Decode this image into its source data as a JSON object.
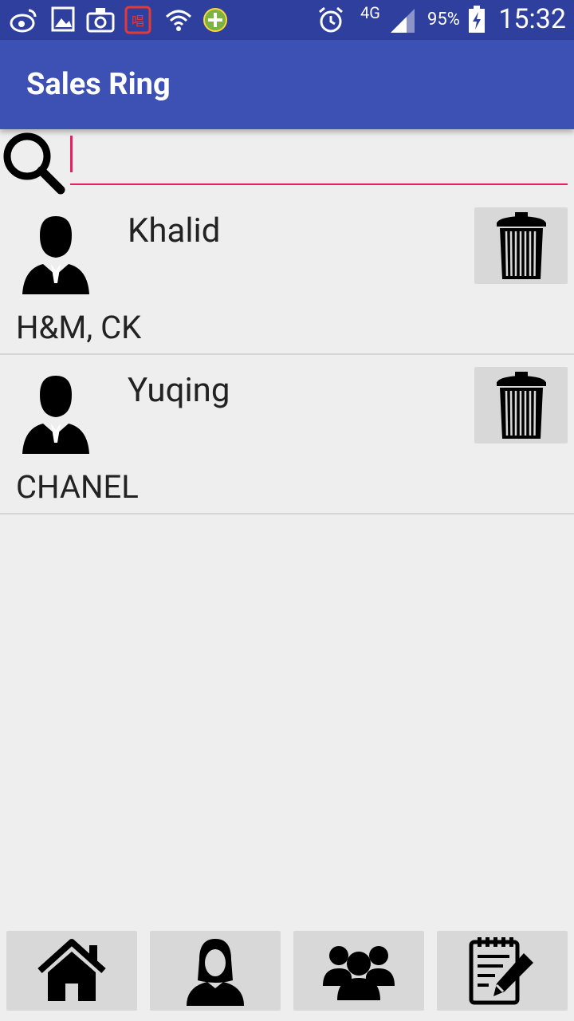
{
  "status_bar": {
    "icons": [
      "weibo-icon",
      "gallery-icon",
      "camera-icon",
      "changba-icon",
      "wifi-icon",
      "plus-app-icon",
      "alarm-icon",
      "signal-icon",
      "battery-charging-icon"
    ],
    "network": "4G",
    "battery": "95%",
    "time": "15:32"
  },
  "app_bar": {
    "title": "Sales Ring"
  },
  "search": {
    "value": "",
    "placeholder": "",
    "accent_color": "#e91e63"
  },
  "contacts": [
    {
      "name": "Khalid",
      "brands": "H&M, CK"
    },
    {
      "name": "Yuqing",
      "brands": "CHANEL"
    }
  ],
  "bottom_nav": [
    "home-icon",
    "woman-profile-icon",
    "group-icon",
    "notepad-icon"
  ],
  "colors": {
    "status_bar": "#2f3f9e",
    "app_bar": "#3d51b4",
    "background": "#eeeeee",
    "button": "#d8d8d8"
  }
}
